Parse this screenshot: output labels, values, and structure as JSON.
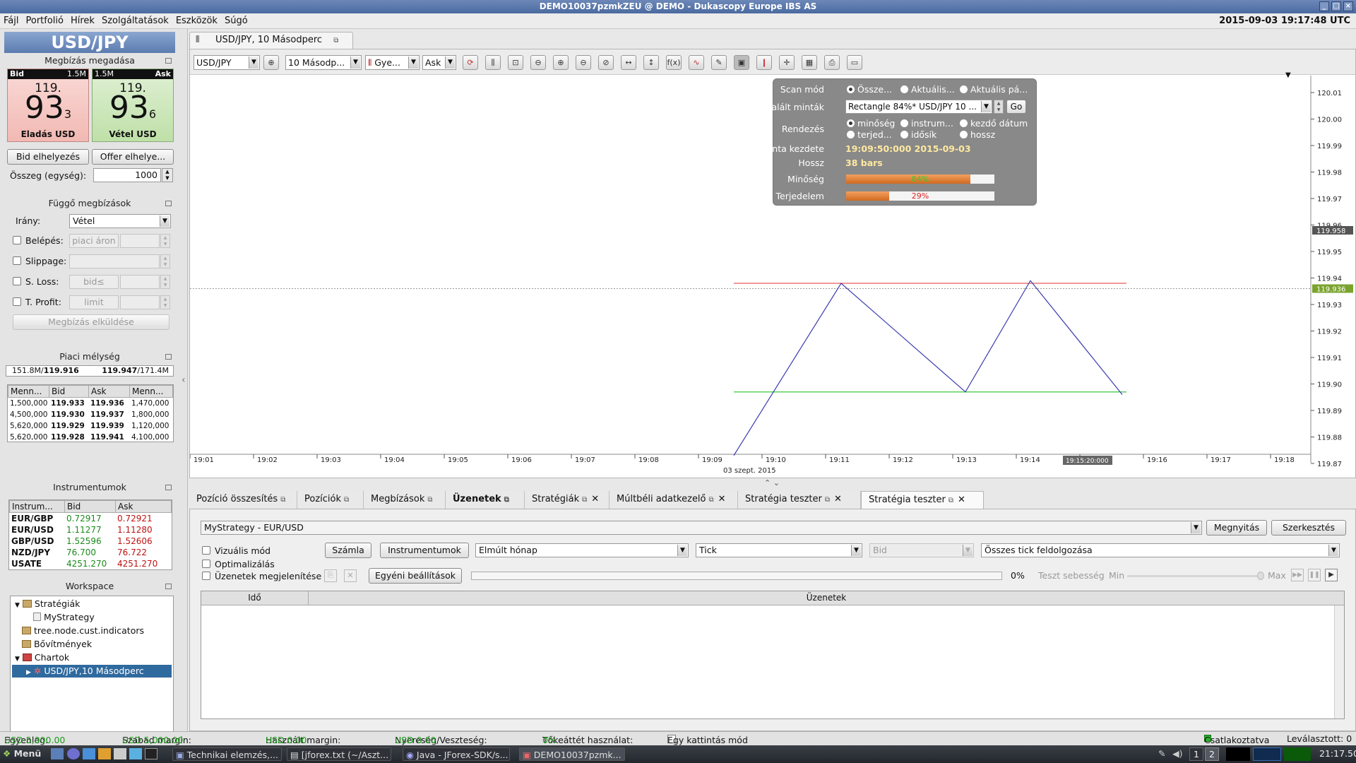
{
  "window": {
    "title": "DEMO10037pzmkZEU @ DEMO - Dukascopy Europe IBS AS"
  },
  "menu": [
    "Fájl",
    "Portfolió",
    "Hírek",
    "Szolgáltatások",
    "Eszközök",
    "Súgó"
  ],
  "clock": "2015-09-03 19:17:48 UTC",
  "instrument": {
    "name": "USD/JPY",
    "order_panel_title": "Megbízás megadása",
    "bid": {
      "label": "Bid",
      "volume": "1.5M",
      "big_prefix": "119.",
      "big_digits": "93",
      "pip": "3",
      "action": "Eladás USD"
    },
    "ask": {
      "label": "Ask",
      "volume": "1.5M",
      "big_prefix": "119.",
      "big_digits": "93",
      "pip": "6",
      "action": "Vétel USD"
    },
    "bid_button": "Bid elhelyezés",
    "offer_button": "Offer elhelye...",
    "amount_label": "Összeg (egység):",
    "amount_value": "1000"
  },
  "pending": {
    "title": "Függő megbízások",
    "direction_label": "Irány:",
    "direction_value": "Vétel",
    "entry_label": "Belépés:",
    "entry_value": "piaci áron",
    "slippage_label": "Slippage:",
    "sl_label": "S. Loss:",
    "sl_value": "bid≤",
    "tp_label": "T. Profit:",
    "tp_value": "limit",
    "submit": "Megbízás elküldése"
  },
  "depth": {
    "title": "Piaci mélység",
    "top_left": "151.8M/",
    "top_left_b": "119.916",
    "top_right_b": "119.947",
    "top_right": "/171.4M",
    "headers": [
      "Menn...",
      "Bid",
      "Ask",
      "Menn..."
    ],
    "rows": [
      [
        "1,500,000",
        "119.933",
        "119.936",
        "1,470,000"
      ],
      [
        "4,500,000",
        "119.930",
        "119.937",
        "1,800,000"
      ],
      [
        "5,620,000",
        "119.929",
        "119.939",
        "1,120,000"
      ],
      [
        "5,620,000",
        "119.928",
        "119.941",
        "4,100,000"
      ]
    ]
  },
  "instruments": {
    "title": "Instrumentumok",
    "headers": [
      "Instrum...",
      "Bid",
      "Ask"
    ],
    "rows": [
      [
        "EUR/GBP",
        "0.72917",
        "0.72921"
      ],
      [
        "EUR/USD",
        "1.11277",
        "1.11280"
      ],
      [
        "GBP/USD",
        "1.52596",
        "1.52606"
      ],
      [
        "NZD/JPY",
        "76.700",
        "76.722"
      ],
      [
        "USATE",
        "4251.270",
        "4251.270"
      ]
    ]
  },
  "workspace": {
    "title": "Workspace",
    "items": [
      "Stratégiák",
      "MyStrategy",
      "tree.node.cust.indicators",
      "Bővítmények",
      "Chartok",
      "USD/JPY,10 Másodperc"
    ]
  },
  "chart": {
    "tab_title": "USD/JPY, 10 Másodperc",
    "toolbar": {
      "instrument": "USD/JPY",
      "period": "10 Másodp...",
      "style": "Gye...",
      "side": "Ask"
    },
    "y_ticks": [
      "120.01",
      "120.00",
      "119.99",
      "119.98",
      "119.97",
      "119.96",
      "119.95",
      "119.94",
      "119.93",
      "119.92",
      "119.91",
      "119.90",
      "119.89",
      "119.88",
      "119.87"
    ],
    "y_price_bid": "119.958",
    "y_price_ask": "119.936",
    "x_ticks": [
      "19:01",
      "19:02",
      "19:03",
      "19:04",
      "19:05",
      "19:06",
      "19:07",
      "19:08",
      "19:09",
      "19:10",
      "19:11",
      "19:12",
      "19:13",
      "19:14",
      "19:15:20:000",
      "19:16",
      "19:17",
      "19:18"
    ],
    "date_label": "03 szept. 2015",
    "colors": {
      "bull": "#7aa32d",
      "bear": "#b0161b",
      "pattern": "#3a3ab0",
      "resistance": "#e03030",
      "support": "#5fd05f"
    }
  },
  "scan": {
    "mode_label": "Scan mód",
    "mode_opts": [
      "Össze...",
      "Aktuális...",
      "Aktuális pá..."
    ],
    "found_label": "Talált minták",
    "found_value": "Rectangle 84%* USD/JPY 10 ...",
    "go": "Go",
    "sort_label": "Rendezés",
    "sort_opts": [
      "minőség",
      "instrum...",
      "kezdő dátum",
      "terjed...",
      "idősík",
      "hossz"
    ],
    "start_label": "Minta kezdete",
    "start_value": "19:09:50:000 2015-09-03",
    "length_label": "Hossz",
    "length_value": "38 bars",
    "quality_label": "Minőség",
    "quality_value": "84%",
    "quality_fraction": 0.84,
    "extent_label": "Terjedelem",
    "extent_value": "29%",
    "extent_fraction": 0.29
  },
  "bottom_tabs": [
    "Pozíció összesítés",
    "Pozíciók",
    "Megbízások",
    "Üzenetek",
    "Stratégiák",
    "Múltbéli adatkezelő",
    "Stratégia teszter",
    "Stratégia teszter"
  ],
  "tester": {
    "strategy": "MyStrategy  -  EUR/USD",
    "open": "Megnyitás",
    "edit": "Szerkesztés",
    "visual": "Vizuális mód",
    "optimize": "Optimalizálás",
    "show_msgs": "Üzenetek megjelenítése",
    "account": "Számla",
    "instruments": "Instrumentumok",
    "period": "Elmúlt hónap",
    "tick": "Tick",
    "bid": "Bid",
    "ticks_all": "Összes tick feldolgozása",
    "custom": "Egyéni beállítások",
    "progress": "0%",
    "speed_label": "Teszt sebesség",
    "min": "Min",
    "max": "Max",
    "col_time": "Idő",
    "col_msgs": "Üzenetek"
  },
  "status": {
    "equity_label": "Egyenleg:",
    "equity": "USD 5,000.00",
    "free_label": "Szabad margin:",
    "free": "USD 5,000.00",
    "used_label": "Használt margin:",
    "used": "USD 0.00",
    "pl_label": "Nyereség/Veszteség:",
    "pl": "USD 0.00",
    "lev_label": "Tőkeáttét használat:",
    "lev": "0%",
    "oneclick": "Egy kattintás mód",
    "connected": "Csatlakoztatva",
    "detached": "Leválasztott: 0"
  },
  "taskbar": {
    "menu": "Menü",
    "tasks": [
      "Technikai elemzés,...",
      "[jforex.txt (~/Aszt...",
      "Java - JForex-SDK/s...",
      "DEMO10037pzmk..."
    ],
    "pages": [
      "1",
      "2"
    ],
    "time": "21:17.50"
  }
}
